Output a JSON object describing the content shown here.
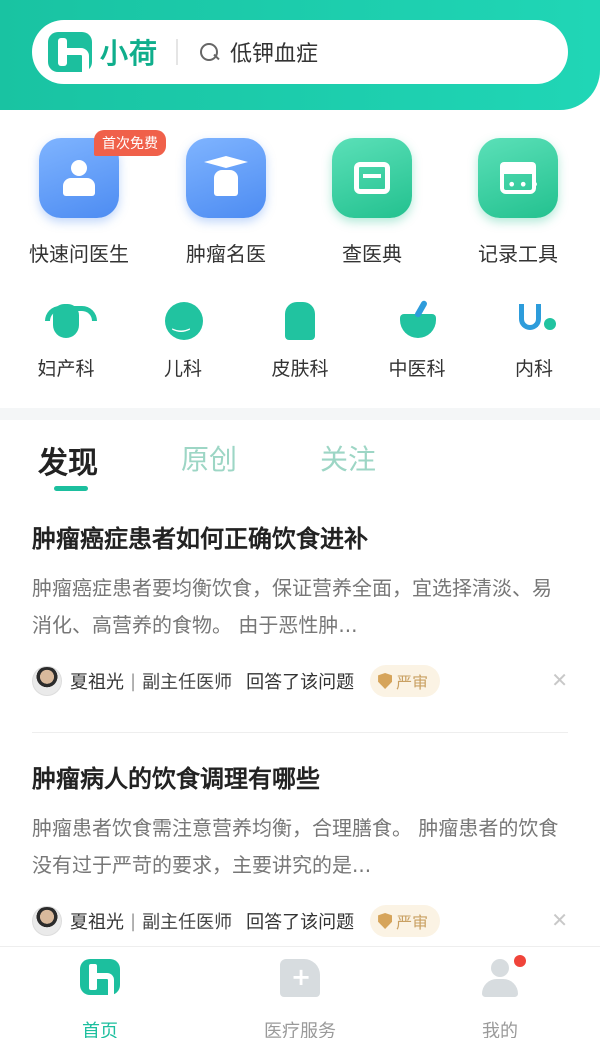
{
  "header": {
    "logo_text": "小荷",
    "search_value": "低钾血症"
  },
  "quick_entries": [
    {
      "label": "快速问医生",
      "badge": "首次免费",
      "icon": "doctor-icon"
    },
    {
      "label": "肿瘤名医",
      "icon": "graduate-doctor-icon"
    },
    {
      "label": "查医典",
      "icon": "book-icon"
    },
    {
      "label": "记录工具",
      "icon": "calendar-icon"
    }
  ],
  "departments": [
    {
      "label": "妇产科",
      "icon": "uterus-icon"
    },
    {
      "label": "儿科",
      "icon": "child-face-icon"
    },
    {
      "label": "皮肤科",
      "icon": "body-icon"
    },
    {
      "label": "中医科",
      "icon": "mortar-icon"
    },
    {
      "label": "内科",
      "icon": "stethoscope-icon"
    }
  ],
  "tabs": [
    "发现",
    "原创",
    "关注"
  ],
  "active_tab": "发现",
  "articles": [
    {
      "title": "肿瘤癌症患者如何正确饮食进补",
      "summary": "肿瘤癌症患者要均衡饮食，保证营养全面，宜选择清淡、易消化、高营养的食物。 由于恶性肿...",
      "author": "夏祖光",
      "separator": "|",
      "author_title": "副主任医师",
      "action": "回答了该问题",
      "review_tag": "严审"
    },
    {
      "title": "肿瘤病人的饮食调理有哪些",
      "summary": "肿瘤患者饮食需注意营养均衡，合理膳食。 肿瘤患者的饮食没有过于严苛的要求，主要讲究的是...",
      "author": "夏祖光",
      "separator": "|",
      "author_title": "副主任医师",
      "action": "回答了该问题",
      "review_tag": "严审"
    }
  ],
  "bottom_nav": [
    {
      "label": "首页",
      "icon": "home-logo-icon",
      "active": true
    },
    {
      "label": "医疗服务",
      "icon": "hospital-icon",
      "active": false
    },
    {
      "label": "我的",
      "icon": "user-icon",
      "active": false,
      "has_notification": true
    }
  ],
  "colors": {
    "brand": "#1cbf9e",
    "header_gradient_start": "#19c3a2",
    "header_gradient_end": "#20d6b6",
    "badge": "#f0604a",
    "review_text": "#c9a062"
  }
}
